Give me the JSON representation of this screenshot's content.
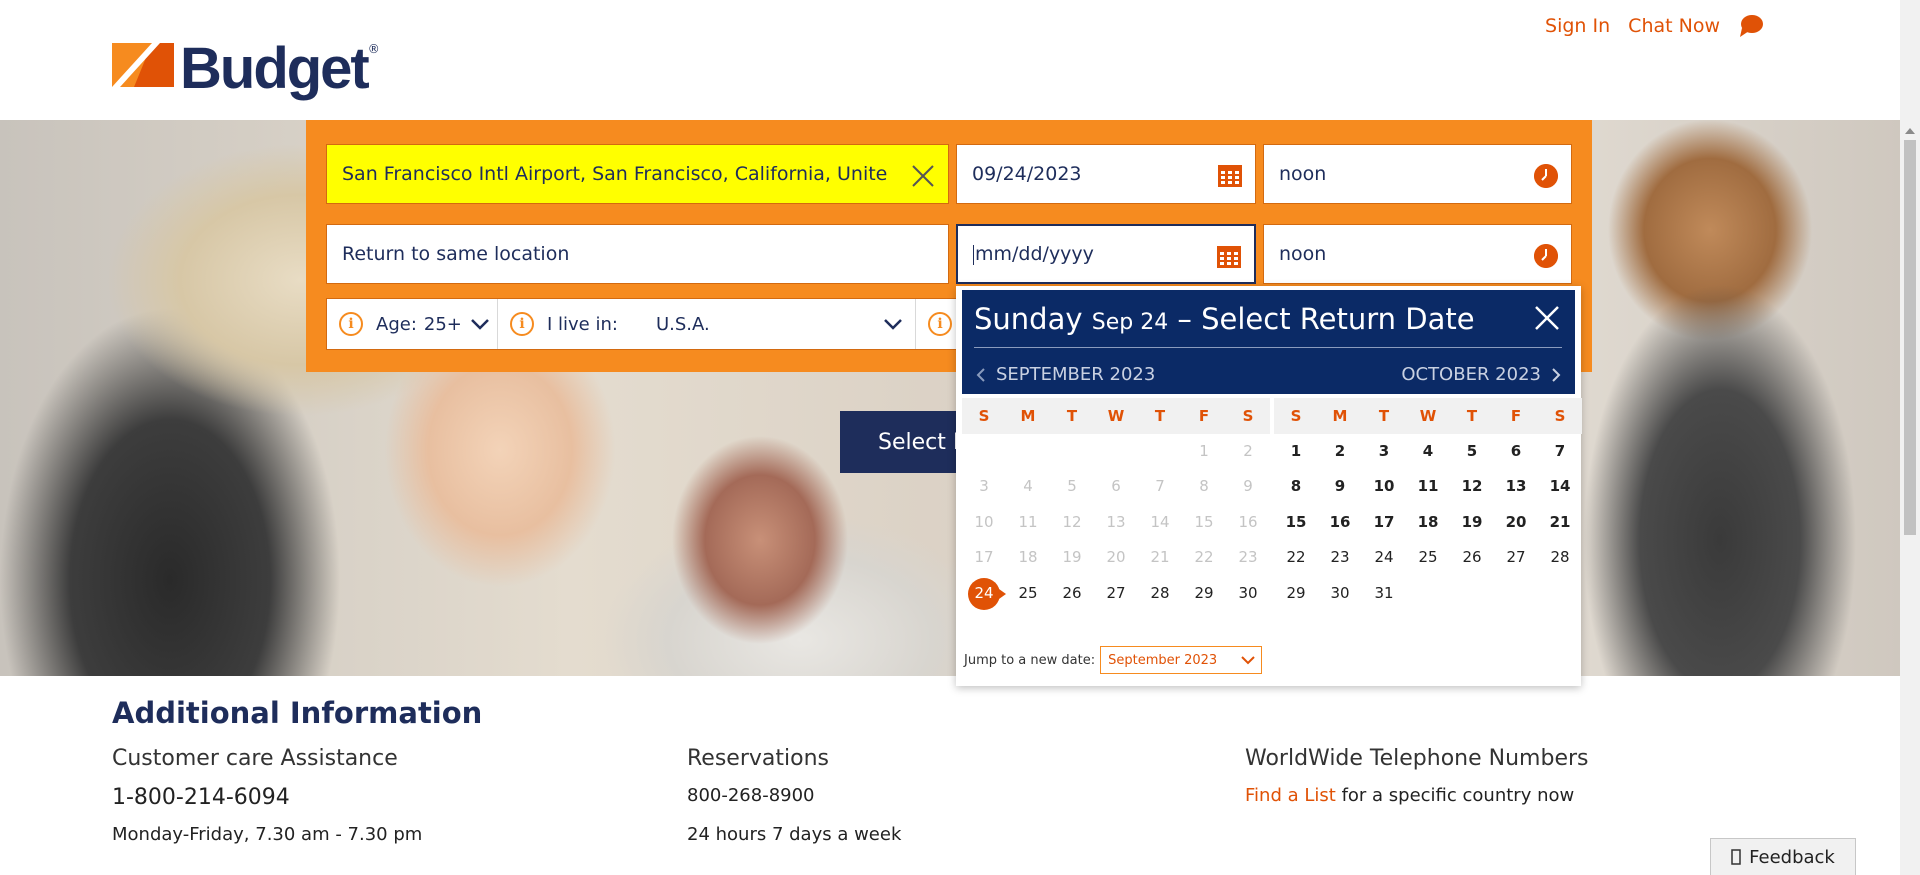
{
  "header": {
    "brand": "Budget",
    "brand_reg": "®",
    "sign_in": "Sign In",
    "chat_now": "Chat Now"
  },
  "booking": {
    "pickup_location": "San Francisco Intl Airport, San Francisco, California, United States-",
    "pickup_date": "09/24/2023",
    "pickup_time": "noon",
    "return_location": "Return to same location",
    "return_date_placeholder": "mm/dd/yyyy",
    "return_time": "noon",
    "age_label": "Age:",
    "age_value": "25+",
    "residence_label": "I live in:",
    "residence_value": "U.S.A.",
    "select_button": "Select M"
  },
  "calendar": {
    "title_day": "Sunday",
    "title_date": "Sep 24",
    "title_rest": "– Select Return Date",
    "month_left": "SEPTEMBER 2023",
    "month_right": "OCTOBER 2023",
    "weekdays": [
      "S",
      "M",
      "T",
      "W",
      "T",
      "F",
      "S"
    ],
    "jump_label": "Jump to a new date:",
    "jump_value": "September 2023",
    "sep_weeks": [
      [
        "",
        "",
        "",
        "",
        "",
        "1",
        "2"
      ],
      [
        "3",
        "4",
        "5",
        "6",
        "7",
        "8",
        "9"
      ],
      [
        "10",
        "11",
        "12",
        "13",
        "14",
        "15",
        "16"
      ],
      [
        "17",
        "18",
        "19",
        "20",
        "21",
        "22",
        "23"
      ],
      [
        "24",
        "25",
        "26",
        "27",
        "28",
        "29",
        "30"
      ]
    ],
    "oct_weeks": [
      [
        "1",
        "2",
        "3",
        "4",
        "5",
        "6",
        "7"
      ],
      [
        "8",
        "9",
        "10",
        "11",
        "12",
        "13",
        "14"
      ],
      [
        "15",
        "16",
        "17",
        "18",
        "19",
        "20",
        "21"
      ],
      [
        "22",
        "23",
        "24",
        "25",
        "26",
        "27",
        "28"
      ],
      [
        "29",
        "30",
        "31",
        "",
        "",
        "",
        ""
      ]
    ],
    "selected_day": "24"
  },
  "additional": {
    "title": "Additional Information",
    "customer_care_title": "Customer care Assistance",
    "customer_care_phone": "1-800-214-6094",
    "customer_care_hours": "Monday-Friday, 7.30 am - 7.30 pm",
    "reservations_title": "Reservations",
    "reservations_phone": "800-268-8900",
    "reservations_hours": "24 hours 7 days a week",
    "worldwide_title": "WorldWide Telephone Numbers",
    "worldwide_link": "Find a List",
    "worldwide_text": "for a specific country now"
  },
  "feedback": "Feedback",
  "colors": {
    "brand_navy": "#1e2d5b",
    "brand_orange": "#f68b1f",
    "accent_orange": "#e05206",
    "calendar_header": "#0b2a66",
    "highlight_yellow": "#ffff00"
  }
}
